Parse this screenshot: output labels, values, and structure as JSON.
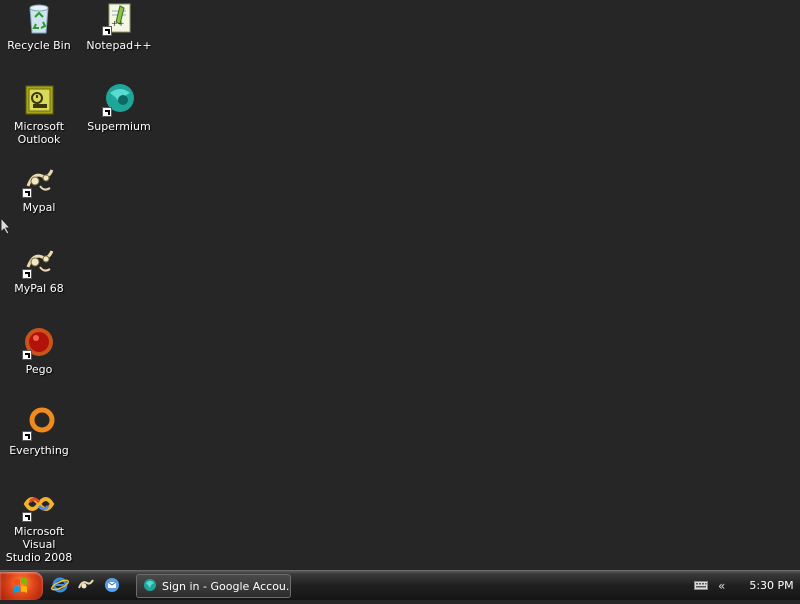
{
  "desktop": {
    "icons": [
      {
        "label": "Recycle Bin",
        "icon": "recycle-bin-icon"
      },
      {
        "label": "Notepad++",
        "icon": "notepad-plus-plus-icon"
      },
      {
        "label": "Microsoft\nOutlook",
        "icon": "outlook-icon"
      },
      {
        "label": "Supermium",
        "icon": "supermium-icon"
      },
      {
        "label": "Mypal",
        "icon": "mypal-icon"
      },
      {
        "label": "MyPal 68",
        "icon": "mypal-68-icon"
      },
      {
        "label": "Pego",
        "icon": "pego-icon"
      },
      {
        "label": "Everything",
        "icon": "everything-icon"
      },
      {
        "label": "Microsoft Visual\nStudio 2008",
        "icon": "visual-studio-icon"
      }
    ]
  },
  "taskbar": {
    "quick_launch": [
      "internet-explorer-icon",
      "mypal-icon",
      "outlook-express-icon"
    ],
    "task_button_label": "Sign in - Google Accou...",
    "clock": "5:30 PM",
    "tray_chevron": "«"
  },
  "colors": {
    "desktop": "#262626",
    "start": "#e0461a"
  }
}
